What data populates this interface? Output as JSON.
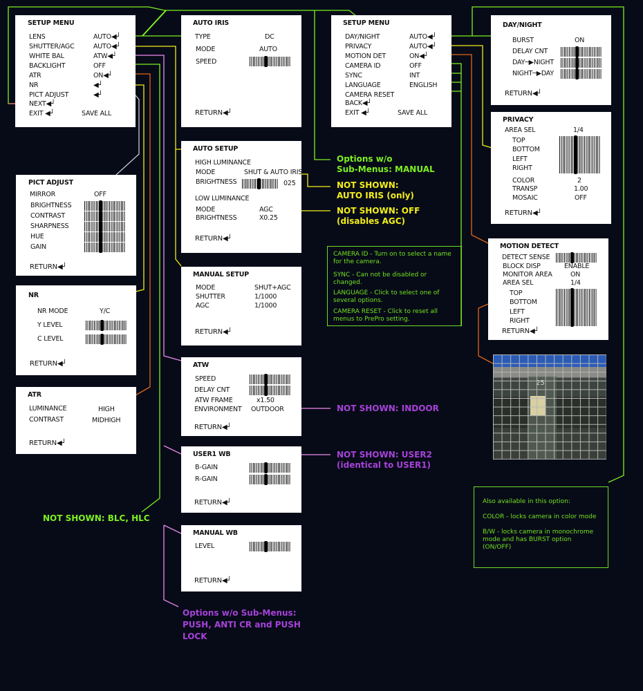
{
  "enter_glyph": "◀┘",
  "setup_menu_1": {
    "title": "SETUP MENU",
    "items": [
      {
        "label": "LENS",
        "value": "AUTO",
        "enter": true
      },
      {
        "label": "SHUTTER/AGC",
        "value": "AUTO",
        "enter": true
      },
      {
        "label": "WHITE BAL",
        "value": "ATW",
        "enter": true
      },
      {
        "label": "BACKLIGHT",
        "value": "OFF",
        "enter": false
      },
      {
        "label": "ATR",
        "value": "ON",
        "enter": true
      },
      {
        "label": "NR",
        "value": "",
        "enter": true
      },
      {
        "label": "PICT ADJUST",
        "value": "",
        "enter": true
      }
    ],
    "next": "NEXT",
    "exit": "EXIT",
    "save_all": "SAVE ALL"
  },
  "auto_iris": {
    "title": "AUTO IRIS",
    "type_label": "TYPE",
    "type_value": "DC",
    "mode_label": "MODE",
    "mode_value": "AUTO",
    "speed_label": "SPEED",
    "speed_level": 0.38,
    "return": "RETURN"
  },
  "auto_setup": {
    "title": "AUTO SETUP",
    "high_heading": "HIGH LUMINANCE",
    "high_mode_label": "MODE",
    "high_mode_value": "SHUT & AUTO IRIS",
    "high_brightness_label": "BRIGHTNESS",
    "high_brightness_value": "025",
    "high_brightness_level": 0.45,
    "low_heading": "LOW LUMINANCE",
    "low_mode_label": "MODE",
    "low_mode_value": "AGC",
    "low_brightness_label": "BRIGHTNESS",
    "low_brightness_value": "X0.25",
    "return": "RETURN"
  },
  "manual_setup": {
    "title": "MANUAL SETUP",
    "rows": [
      {
        "label": "MODE",
        "value": "SHUT+AGC"
      },
      {
        "label": "SHUTTER",
        "value": "1/1000"
      },
      {
        "label": "AGC",
        "value": "1/1000"
      }
    ],
    "return": "RETURN"
  },
  "atw": {
    "title": "ATW",
    "speed_label": "SPEED",
    "speed_level": 0.38,
    "delay_label": "DELAY CNT",
    "delay_level": 0.38,
    "frame_label": "ATW FRAME",
    "frame_value": "x1.50",
    "env_label": "ENVIRONMENT",
    "env_value": "OUTDOOR",
    "return": "RETURN"
  },
  "user1_wb": {
    "title": "USER1 WB",
    "bgain_label": "B-GAIN",
    "bgain_level": 0.38,
    "rgain_label": "R-GAIN",
    "rgain_level": 0.38,
    "return": "RETURN"
  },
  "manual_wb": {
    "title": "MANUAL WB",
    "level_label": "LEVEL",
    "level_level": 0.38,
    "return": "RETURN"
  },
  "pict_adjust": {
    "title": "PICT ADJUST",
    "mirror_label": "MIRROR",
    "mirror_value": "OFF",
    "sliders": [
      {
        "label": "BRIGHTNESS",
        "level": 0.38
      },
      {
        "label": "CONTRAST",
        "level": 0.38
      },
      {
        "label": "SHARPNESS",
        "level": 0.38
      },
      {
        "label": "HUE",
        "level": 0.38
      },
      {
        "label": "GAIN",
        "level": 0.38
      }
    ],
    "return": "RETURN"
  },
  "nr": {
    "title": "NR",
    "mode_label": "NR MODE",
    "mode_value": "Y/C",
    "y_label": "Y LEVEL",
    "y_level": 0.38,
    "c_label": "C LEVEL",
    "c_level": 0.38,
    "return": "RETURN"
  },
  "atr": {
    "title": "ATR",
    "lum_label": "LUMINANCE",
    "lum_value": "HIGH",
    "con_label": "CONTRAST",
    "con_value": "MIDHIGH",
    "return": "RETURN"
  },
  "setup_menu_2": {
    "title": "SETUP MENU",
    "items": [
      {
        "label": "DAY/NIGHT",
        "value": "AUTO",
        "enter": true
      },
      {
        "label": "PRIVACY",
        "value": "AUTO",
        "enter": true
      },
      {
        "label": "MOTION DET",
        "value": "ON",
        "enter": true
      },
      {
        "label": "CAMERA ID",
        "value": "OFF",
        "enter": false
      },
      {
        "label": "SYNC",
        "value": "INT",
        "enter": false
      },
      {
        "label": "LANGUAGE",
        "value": "ENGLISH",
        "enter": false
      },
      {
        "label": "CAMERA RESET",
        "value": "",
        "enter": false
      }
    ],
    "back": "BACK",
    "exit": "EXIT",
    "save_all": "SAVE ALL"
  },
  "day_night": {
    "title": "DAY/NIGHT",
    "burst_label": "BURST",
    "burst_value": "ON",
    "delay_label": "DELAY CNT",
    "delay_level": 0.38,
    "d2n_label": "DAY",
    "d2n_label2": "NIGHT",
    "d2n_level": 0.38,
    "n2d_label": "NIGHT",
    "n2d_label2": "DAY",
    "n2d_level": 0.38,
    "arrow": "─▶",
    "return": "RETURN"
  },
  "privacy": {
    "title": "PRIVACY",
    "area_label": "AREA SEL",
    "area_value": "1/4",
    "edges": [
      "TOP",
      "BOTTOM",
      "LEFT",
      "RIGHT"
    ],
    "edges_level": 0.38,
    "color_label": "COLOR",
    "color_value": "2",
    "transp_label": "TRANSP",
    "transp_value": "1.00",
    "mosaic_label": "MOSAIC",
    "mosaic_value": "OFF",
    "return": "RETURN"
  },
  "motion_detect": {
    "title": "MOTION DETECT",
    "sense_label": "DETECT SENSE",
    "sense_level": 0.38,
    "block_label": "BLOCK DISP",
    "block_value": "ENABLE",
    "monitor_label": "MONITOR AREA",
    "monitor_value": "ON",
    "area_label": "AREA SEL",
    "area_value": "1/4",
    "edges": [
      "TOP",
      "BOTTOM",
      "LEFT",
      "RIGHT"
    ],
    "edges_level": 0.38,
    "return": "RETURN"
  },
  "photo": {
    "overlay_number": "25"
  },
  "notes": {
    "lens_options": [
      "Options w/o",
      "Sub-Menus: MANUAL"
    ],
    "auto_iris_only": [
      "NOT SHOWN:",
      "AUTO IRIS (only)"
    ],
    "agc_off": [
      "NOT SHOWN: OFF",
      "(disables AGC)"
    ],
    "indoor": "NOT SHOWN: INDOOR",
    "user2": [
      "NOT SHOWN: USER2",
      "(identical to USER1)"
    ],
    "wb_options": [
      "Options w/o Sub-Menus:",
      "PUSH, ANTI CR and PUSH",
      "LOCK"
    ],
    "blc_hlc": "NOT SHOWN: BLC, HLC"
  },
  "info_box_1": [
    "CAMERA ID - Turn on to select a name for the camera.",
    "SYNC - Can not be disabled or changed.",
    "LANGUAGE - Click to select one of several options.",
    "CAMERA RESET  -  Click to reset all menus to PrePro setting."
  ],
  "info_box_2": [
    "Also available in this option:",
    "COLOR - locks camera in color mode",
    "B/W - locks camera in monochrome mode and has BURST option (ON/OFF)"
  ],
  "colors": {
    "green": "#7df01f",
    "yellow": "#f4ee16",
    "orange": "#e0661c",
    "pink": "#ee8aee",
    "purple": "#a642d8",
    "salmon": "#f07070",
    "background": "#070b18"
  }
}
